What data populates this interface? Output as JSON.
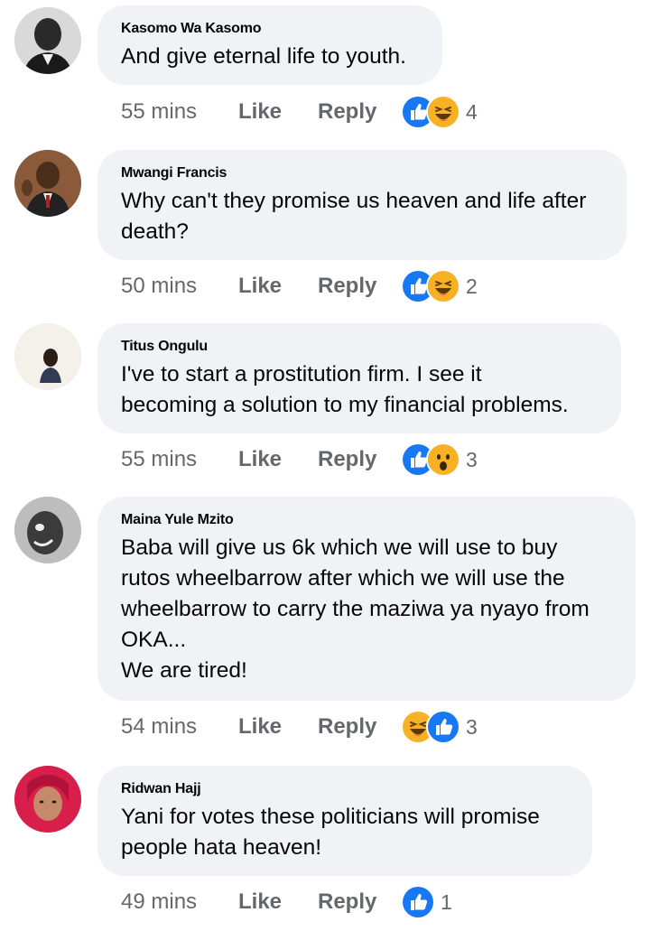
{
  "comments": [
    {
      "author": "Kasomo Wa Kasomo",
      "text": "And give eternal life to youth.",
      "time": "55 mins",
      "like_label": "Like",
      "reply_label": "Reply",
      "reactions": [
        "like-icon",
        "laugh-icon"
      ],
      "reaction_count": "4"
    },
    {
      "author": "Mwangi Francis",
      "text": "Why can't they promise us heaven and life after\ndeath?",
      "time": "50 mins",
      "like_label": "Like",
      "reply_label": "Reply",
      "reactions": [
        "like-icon",
        "laugh-icon"
      ],
      "reaction_count": "2"
    },
    {
      "author": "Titus Ongulu",
      "text": "I've to start a prostitution firm. I see it\nbecoming a solution to my financial problems.",
      "time": "55 mins",
      "like_label": "Like",
      "reply_label": "Reply",
      "reactions": [
        "like-icon",
        "wow-icon"
      ],
      "reaction_count": "3"
    },
    {
      "author": "Maina Yule Mzito",
      "text": "Baba will give us 6k which we will use to buy\nrutos wheelbarrow after which we will use the\nwheelbarrow to carry the maziwa ya nyayo from\nOKA...\nWe are tired!",
      "time": "54 mins",
      "like_label": "Like",
      "reply_label": "Reply",
      "reactions": [
        "laugh-icon",
        "like-icon"
      ],
      "reaction_count": "3"
    },
    {
      "author": "Ridwan Hajj",
      "text": "Yani for votes these politicians will promise\npeople hata heaven!",
      "time": "49 mins",
      "like_label": "Like",
      "reply_label": "Reply",
      "reactions": [
        "like-icon"
      ],
      "reaction_count": "1"
    }
  ],
  "colors": {
    "like_blue": "#1877f2",
    "reaction_yellow": "#f7b125",
    "bubble_bg": "#f0f2f5",
    "meta_gray": "#65676b"
  }
}
